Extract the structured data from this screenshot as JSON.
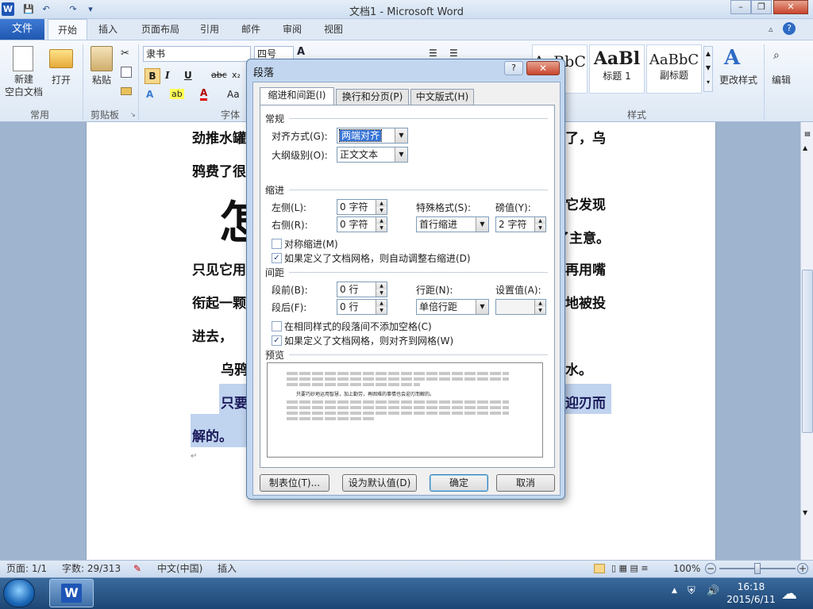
{
  "window": {
    "title": "文档1 - Microsoft Word",
    "minimize": "–",
    "restore": "❐",
    "close": "✕"
  },
  "qat": {
    "save": "💾",
    "undo": "↶",
    "redo": "↷",
    "more": "▾"
  },
  "tabs": [
    "文件",
    "开始",
    "插入",
    "页面布局",
    "引用",
    "邮件",
    "审阅",
    "视图"
  ],
  "ribbon": {
    "new_label": "新建\n空白文档",
    "open_label": "打开",
    "paste_label": "粘贴",
    "font_name": "隶书",
    "font_size": "四号",
    "styles": [
      {
        "sample": "AaBbC",
        "name": ""
      },
      {
        "sample": "AaBl",
        "name": "标题 1"
      },
      {
        "sample": "AaBbC",
        "name": "副标题"
      }
    ],
    "change_styles_label": "更改样式",
    "edit_label": "编辑",
    "groups": {
      "common": "常用",
      "clipboard": "剪贴板",
      "font": "字体",
      "styles": "样式"
    }
  },
  "document": {
    "lines": [
      "劲推水罐",
      "了，乌",
      "鸦费了很",
      "它发现",
      "了主意。",
      "只见它用",
      "再用嘴",
      "衔起一颗",
      "地被投",
      "进去，",
      "乌鸦",
      "水。",
      "只要",
      "迎刃而",
      "解的。"
    ],
    "big_char": "怎",
    "para_mark": "↵"
  },
  "status": {
    "page": "页面: 1/1",
    "words": "字数: 29/313",
    "lang": "中文(中国)",
    "mode": "插入",
    "zoom": "100%"
  },
  "taskbar": {
    "time": "16:18",
    "date": "2015/6/11"
  },
  "dialog": {
    "title": "段落",
    "help": "?",
    "close": "✕",
    "tabs": [
      "缩进和间距(I)",
      "换行和分页(P)",
      "中文版式(H)"
    ],
    "general": {
      "title": "常规",
      "align_label": "对齐方式(G):",
      "align_value": "两端对齐",
      "outline_label": "大纲级别(O):",
      "outline_value": "正文文本"
    },
    "indent": {
      "title": "缩进",
      "left_label": "左侧(L):",
      "left_value": "0 字符",
      "right_label": "右侧(R):",
      "right_value": "0 字符",
      "special_label": "特殊格式(S):",
      "special_value": "首行缩进",
      "by_label": "磅值(Y):",
      "by_value": "2 字符",
      "mirror_label": "对称缩进(M)",
      "mirror_checked": false,
      "autoadjust_label": "如果定义了文档网格，则自动调整右缩进(D)",
      "autoadjust_checked": true
    },
    "spacing": {
      "title": "间距",
      "before_label": "段前(B):",
      "before_value": "0 行",
      "after_label": "段后(F):",
      "after_value": "0 行",
      "line_label": "行距(N):",
      "line_value": "单倍行距",
      "at_label": "设置值(A):",
      "at_value": "",
      "nospace_label": "在相同样式的段落间不添加空格(C)",
      "nospace_checked": false,
      "snap_label": "如果定义了文档网格，则对齐到网格(W)",
      "snap_checked": true
    },
    "preview": {
      "title": "预览",
      "sample": "只要巧妙地运用智慧，加上勤劳，再困难的事情也会迎刃而解的。"
    },
    "buttons": {
      "tabs": "制表位(T)...",
      "default": "设为默认值(D)",
      "ok": "确定",
      "cancel": "取消"
    }
  }
}
